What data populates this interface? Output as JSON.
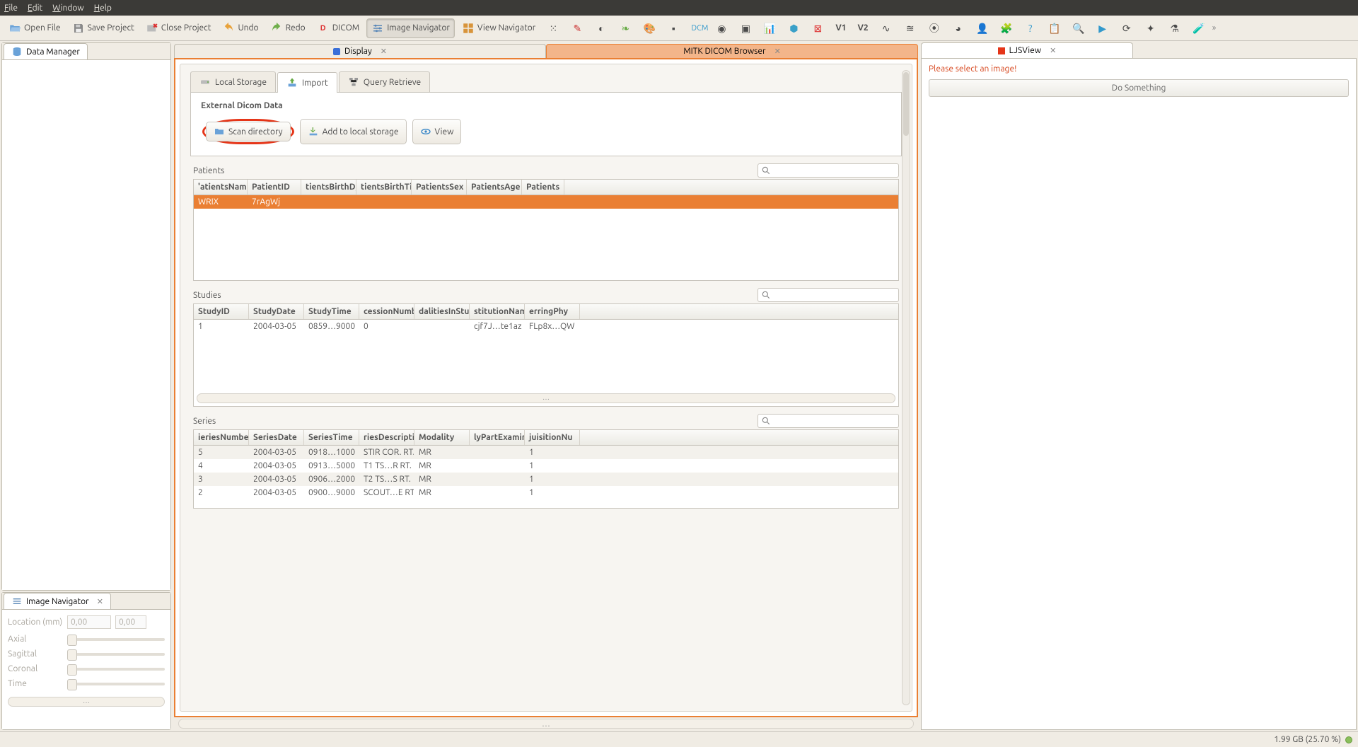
{
  "menubar": {
    "file": "File",
    "edit": "Edit",
    "window": "Window",
    "help": "Help"
  },
  "toolbar": {
    "open": "Open File",
    "save": "Save Project",
    "close": "Close Project",
    "undo": "Undo",
    "redo": "Redo",
    "dicom": "DICOM",
    "image_nav": "Image Navigator",
    "view_nav": "View Navigator",
    "v1": "V1",
    "v2": "V2"
  },
  "left": {
    "data_manager": "Data Manager",
    "image_navigator": "Image Navigator",
    "loc_label": "Location (mm)",
    "loc_a": "0,00",
    "loc_b": "0,00",
    "axial": "Axial",
    "sagittal": "Sagittal",
    "coronal": "Coronal",
    "time": "Time"
  },
  "center": {
    "tab_display": "Display",
    "tab_browser": "MITK DICOM Browser",
    "sub_local": "Local Storage",
    "sub_import": "Import",
    "sub_query": "Query Retrieve",
    "section": "External Dicom Data",
    "btn_scan": "Scan directory",
    "btn_add": "Add to local storage",
    "btn_view": "View",
    "patients": {
      "title": "Patients",
      "headers": [
        "'atientsName",
        "PatientID",
        "tientsBirthD;",
        "tientsBirthTi",
        "PatientsSex",
        "PatientsAge",
        "Patients"
      ],
      "rows": [
        [
          "WRIX",
          "7rAgWj",
          "",
          "",
          "",
          "",
          ""
        ]
      ]
    },
    "studies": {
      "title": "Studies",
      "headers": [
        "StudyID",
        "StudyDate",
        "StudyTime",
        "cessionNumb",
        "dalitiesInStu",
        "stitutionNam",
        "erringPhy"
      ],
      "rows": [
        [
          "1",
          "2004-03-05",
          "0859…9000",
          "0",
          "",
          "cjf7J…te1az",
          "FLp8x…QW"
        ]
      ]
    },
    "series": {
      "title": "Series",
      "headers": [
        "ieriesNumbe",
        "SeriesDate",
        "SeriesTime",
        "riesDescripti",
        "Modality",
        "lyPartExamin",
        "juisitionNu"
      ],
      "rows": [
        [
          "5",
          "2004-03-05",
          "0918…1000",
          "STIR COR. RT.",
          "MR",
          "",
          "1"
        ],
        [
          "4",
          "2004-03-05",
          "0913…5000",
          "T1 TS…R RT.",
          "MR",
          "",
          "1"
        ],
        [
          "3",
          "2004-03-05",
          "0906…2000",
          "T2 TS…S RT.",
          "MR",
          "",
          "1"
        ],
        [
          "2",
          "2004-03-05",
          "0900…9000",
          "SCOUT…E RT.",
          "MR",
          "",
          "1"
        ]
      ]
    }
  },
  "right": {
    "tab": "LJSView",
    "warn": "Please select an image!",
    "do": "Do Something"
  },
  "status": {
    "mem": "1.99 GB (25.70 %)"
  }
}
